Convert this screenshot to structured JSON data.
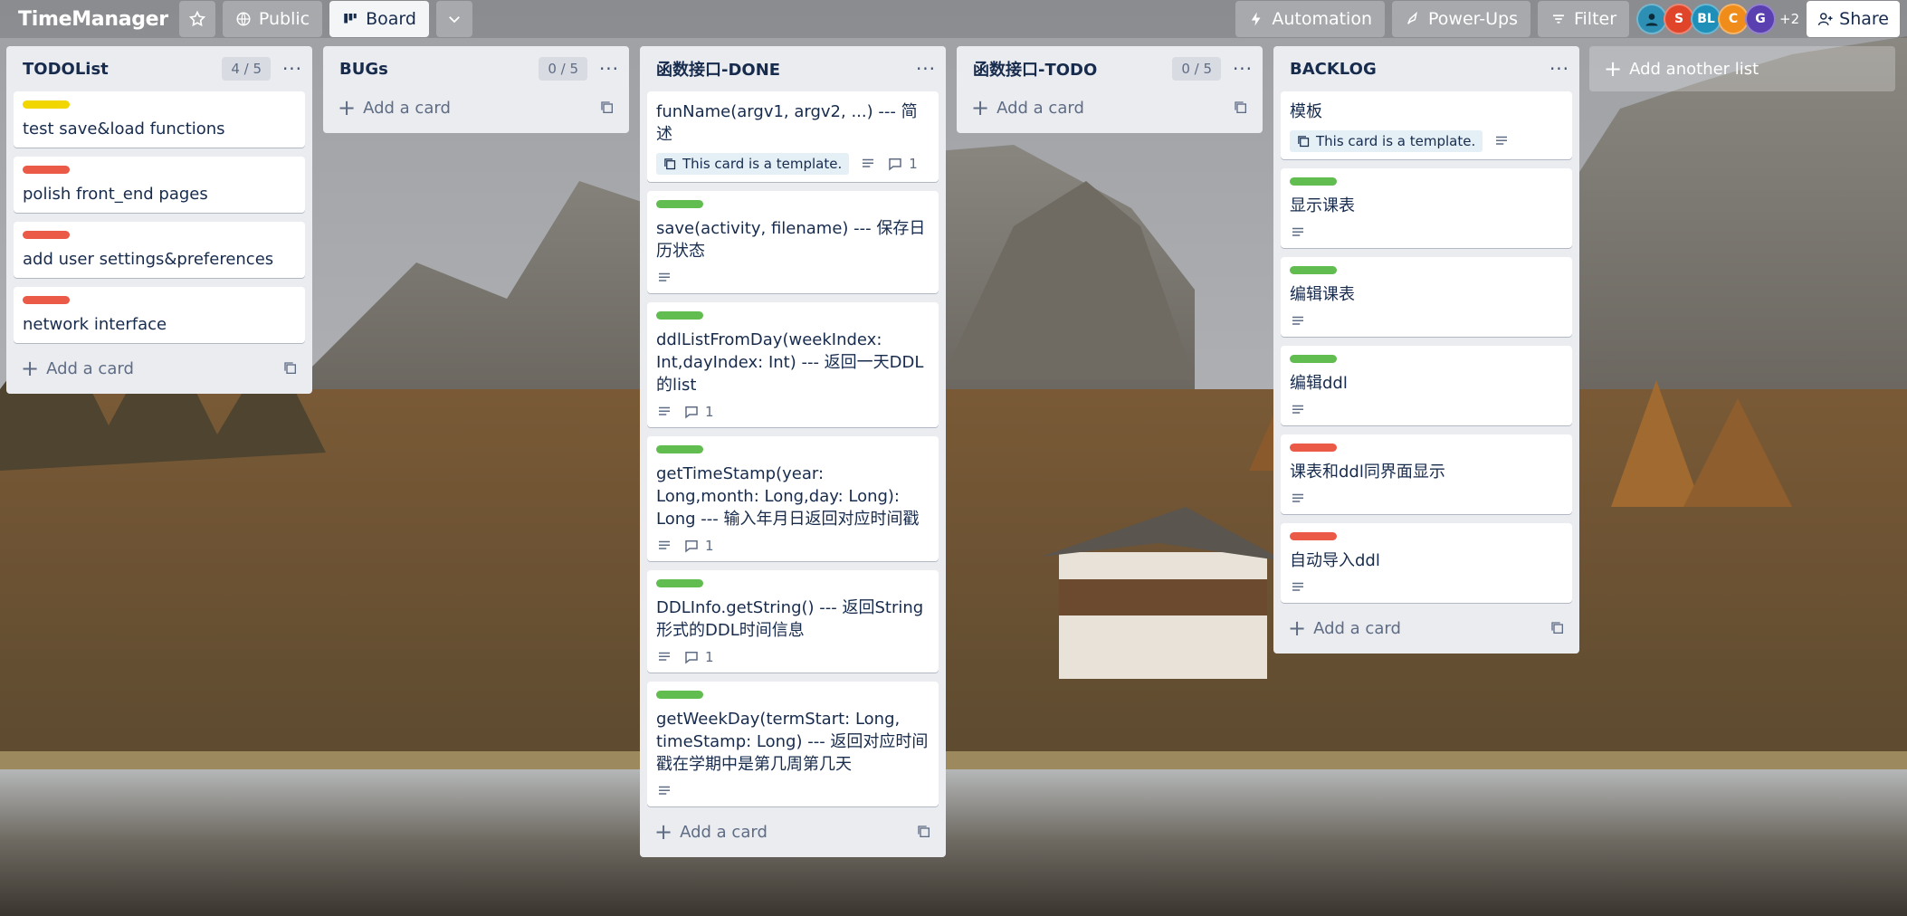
{
  "header": {
    "brand": "TimeManager",
    "visibility": "Public",
    "view": "Board",
    "automation": "Automation",
    "powerups": "Power-Ups",
    "filter": "Filter",
    "avatars": [
      {
        "initials": "",
        "color": "#2d8fb3"
      },
      {
        "initials": "S",
        "color": "#e0452a"
      },
      {
        "initials": "BL",
        "color": "#1d8fb8"
      },
      {
        "initials": "C",
        "color": "#f08c1a"
      },
      {
        "initials": "G",
        "color": "#5a3fb0"
      }
    ],
    "more_members": "+2",
    "share": "Share"
  },
  "colors": {
    "green": "#61bd4f",
    "red": "#eb5a46",
    "yellow": "#f2d600"
  },
  "lists": [
    {
      "title": "TODOList",
      "count": "4 / 5",
      "cards": [
        {
          "label": "yellow",
          "text": "test save&load functions"
        },
        {
          "label": "red",
          "text": "polish front_end pages"
        },
        {
          "label": "red",
          "text": "add user settings&preferences"
        },
        {
          "label": "red",
          "text": "network interface"
        }
      ],
      "add_card": "Add a card"
    },
    {
      "title": "BUGs",
      "count": "0 / 5",
      "cards": [],
      "add_card": "Add a card"
    },
    {
      "title": "函数接口-DONE",
      "count": "",
      "cards": [
        {
          "label": "",
          "text": "funName(argv1, argv2, ...) --- 简述",
          "template": "This card is a template.",
          "desc": true,
          "comments": "1"
        },
        {
          "label": "green",
          "text": "save(activity, filename) --- 保存日历状态",
          "desc": true
        },
        {
          "label": "green",
          "text": "ddlListFromDay(weekIndex: Int,dayIndex: Int) --- 返回一天DDL的list",
          "desc": true,
          "comments": "1"
        },
        {
          "label": "green",
          "text": "getTimeStamp(year: Long,month: Long,day: Long): Long --- 输入年月日返回对应时间戳",
          "desc": true,
          "comments": "1"
        },
        {
          "label": "green",
          "text": "DDLInfo.getString() --- 返回String形式的DDL时间信息",
          "desc": true,
          "comments": "1"
        },
        {
          "label": "green",
          "text": "getWeekDay(termStart: Long, timeStamp: Long) --- 返回对应时间戳在学期中是第几周第几天",
          "desc": true
        }
      ],
      "add_card": "Add a card"
    },
    {
      "title": "函数接口-TODO",
      "count": "0 / 5",
      "cards": [],
      "add_card": "Add a card"
    },
    {
      "title": "BACKLOG",
      "count": "",
      "cards": [
        {
          "label": "",
          "text": "模板",
          "template": "This card is a template.",
          "desc": true
        },
        {
          "label": "green",
          "text": "显示课表",
          "desc": true
        },
        {
          "label": "green",
          "text": "编辑课表",
          "desc": true
        },
        {
          "label": "green",
          "text": "编辑ddl",
          "desc": true
        },
        {
          "label": "red",
          "text": "课表和ddl同界面显示",
          "desc": true
        },
        {
          "label": "red",
          "text": "自动导入ddl",
          "desc": true
        }
      ],
      "add_card": "Add a card"
    }
  ],
  "add_list": "Add another list"
}
